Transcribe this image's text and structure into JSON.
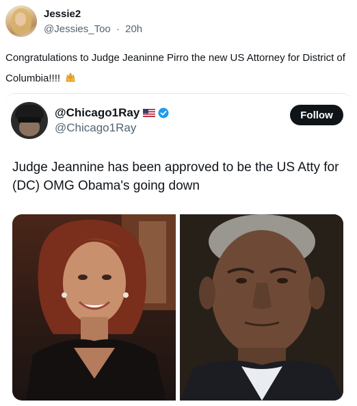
{
  "outer_post": {
    "display_name": "Jessie2",
    "handle": "@Jessies_Too",
    "separator": "·",
    "time": "20h",
    "text": "Congratulations to Judge Jeaninne Pirro the new US Attorney for District of Columbia!!!!",
    "emoji": "raising-hands-emoji"
  },
  "quoted_post": {
    "display_name": "@Chicago1Ray",
    "handle": "@Chicago1Ray",
    "follow_label": "Follow",
    "text": "Judge Jeannine has been approved to be the US Atty for (DC) OMG Obama's going down",
    "badges": [
      "us-flag-icon",
      "verified-badge-icon"
    ],
    "media": [
      {
        "name": "photo-woman-portrait"
      },
      {
        "name": "photo-man-portrait"
      }
    ]
  },
  "colors": {
    "text_primary": "#0f1419",
    "text_secondary": "#536471",
    "verified": "#1d9bf0",
    "follow_bg": "#0f1419"
  }
}
